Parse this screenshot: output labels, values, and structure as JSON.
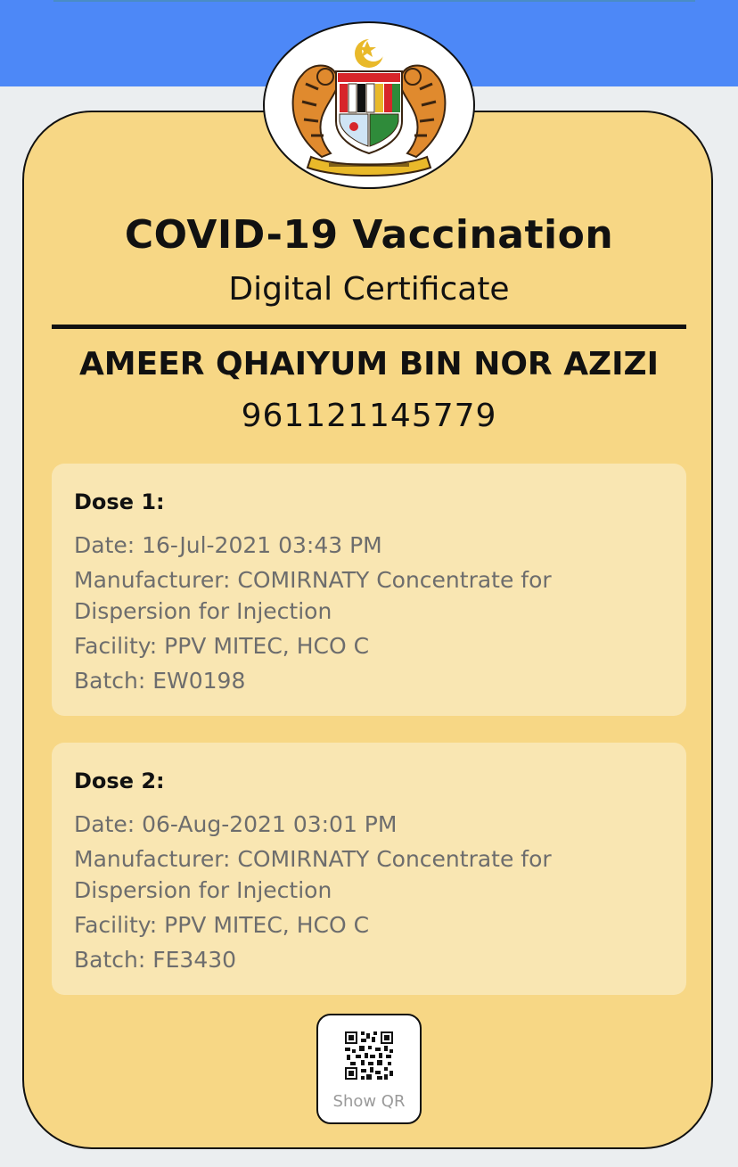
{
  "certificate": {
    "title": "COVID-19 Vaccination",
    "subtitle": "Digital Certificate"
  },
  "holder": {
    "name": "AMEER QHAIYUM BIN NOR AZIZI",
    "id_number": "961121145779"
  },
  "doses": [
    {
      "title": "Dose 1:",
      "date": "Date: 16-Jul-2021 03:43 PM",
      "manufacturer_line1": "Manufacturer: COMIRNATY Concentrate for",
      "manufacturer_line2": "Dispersion for Injection",
      "facility": "Facility: PPV MITEC, HCO C",
      "batch": "Batch: EW0198"
    },
    {
      "title": "Dose 2:",
      "date": "Date: 06-Aug-2021 03:01 PM",
      "manufacturer_line1": "Manufacturer: COMIRNATY Concentrate for",
      "manufacturer_line2": "Dispersion for Injection",
      "facility": "Facility: PPV MITEC, HCO C",
      "batch": "Batch: FE3430"
    }
  ],
  "qr_button": {
    "label": "Show QR",
    "icon": "qr-code-icon"
  },
  "emblem": {
    "icon": "coat-of-arms-icon"
  },
  "colors": {
    "header_blue": "#4d88f7",
    "page_bg": "#ebeef0",
    "card_bg": "#f7d785",
    "dose_bg": "#f9e6b2",
    "dose_text": "#6d6d6d"
  }
}
